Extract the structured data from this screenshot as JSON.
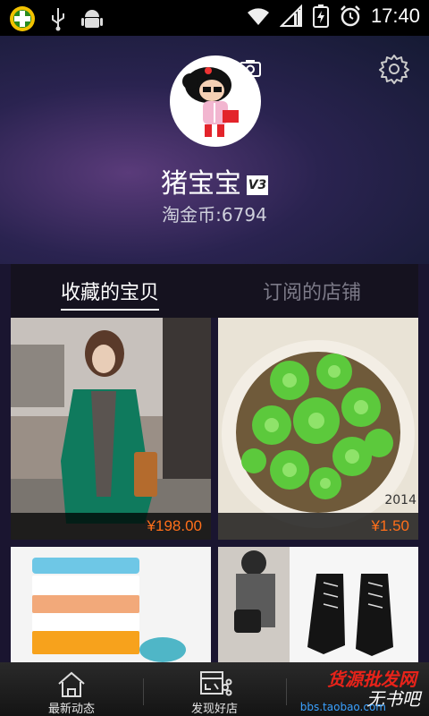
{
  "status_bar": {
    "time": "17:40"
  },
  "profile": {
    "username": "猪宝宝",
    "level_badge": "V3",
    "coins_text": "淘金币:6794"
  },
  "tabs": [
    {
      "label": "收藏的宝贝",
      "active": true
    },
    {
      "label": "订阅的店铺",
      "active": false
    }
  ],
  "products": [
    {
      "price": "¥198.00"
    },
    {
      "price": "¥1.50",
      "watermark": "2014"
    },
    {
      "price": ""
    },
    {
      "price": ""
    }
  ],
  "bottom_nav": [
    {
      "label": "最新动态",
      "icon": "home-icon"
    },
    {
      "label": "发现好店",
      "icon": "discover-shop-icon"
    }
  ],
  "watermark": {
    "line1": "货源批发网",
    "line2": "无书吧",
    "line3": "bbs.taobao.com"
  },
  "colors": {
    "price": "#ff6f1a",
    "tab_active": "#ffffff",
    "tab_inactive": "#7c7a88"
  }
}
